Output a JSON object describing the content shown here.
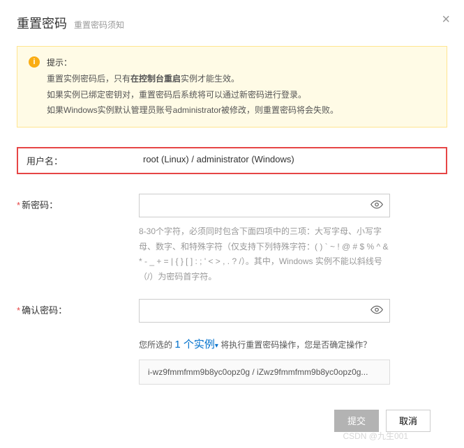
{
  "header": {
    "title": "重置密码",
    "subtitle": "重置密码须知"
  },
  "alert": {
    "title": "提示：",
    "line1_pre": "重置实例密码后，只有",
    "line1_bold": "在控制台重启",
    "line1_post": "实例才能生效。",
    "line2": "如果实例已绑定密钥对，重置密码后系统将可以通过新密码进行登录。",
    "line3": "如果Windows实例默认管理员账号administrator被修改，则重置密码将会失败。"
  },
  "form": {
    "username_label": "用户名：",
    "username_value": "root (Linux) / administrator (Windows)",
    "newpass_label": "新密码：",
    "newpass_hint": "8-30个字符，必须同时包含下面四项中的三项：大写字母、小写字母、数字、和特殊字符（仅支持下列特殊字符：( ) ` ~ ! @ # $ % ^ & * - _ + = | { } [ ] : ; ' < > , . ? /）。其中，Windows 实例不能以斜线号（/）为密码首字符。",
    "confirm_label": "确认密码："
  },
  "confirm_section": {
    "text_pre": "您所选的 ",
    "count": "1 个实例",
    "text_post": " 将执行重置密码操作，您是否确定操作？",
    "instance": "i-wz9fmmfmm9b8yc0opz0g / iZwz9fmmfmm9b8yc0opz0g..."
  },
  "footer": {
    "submit": "提交",
    "cancel": "取消"
  },
  "watermark": "CSDN @九生001"
}
